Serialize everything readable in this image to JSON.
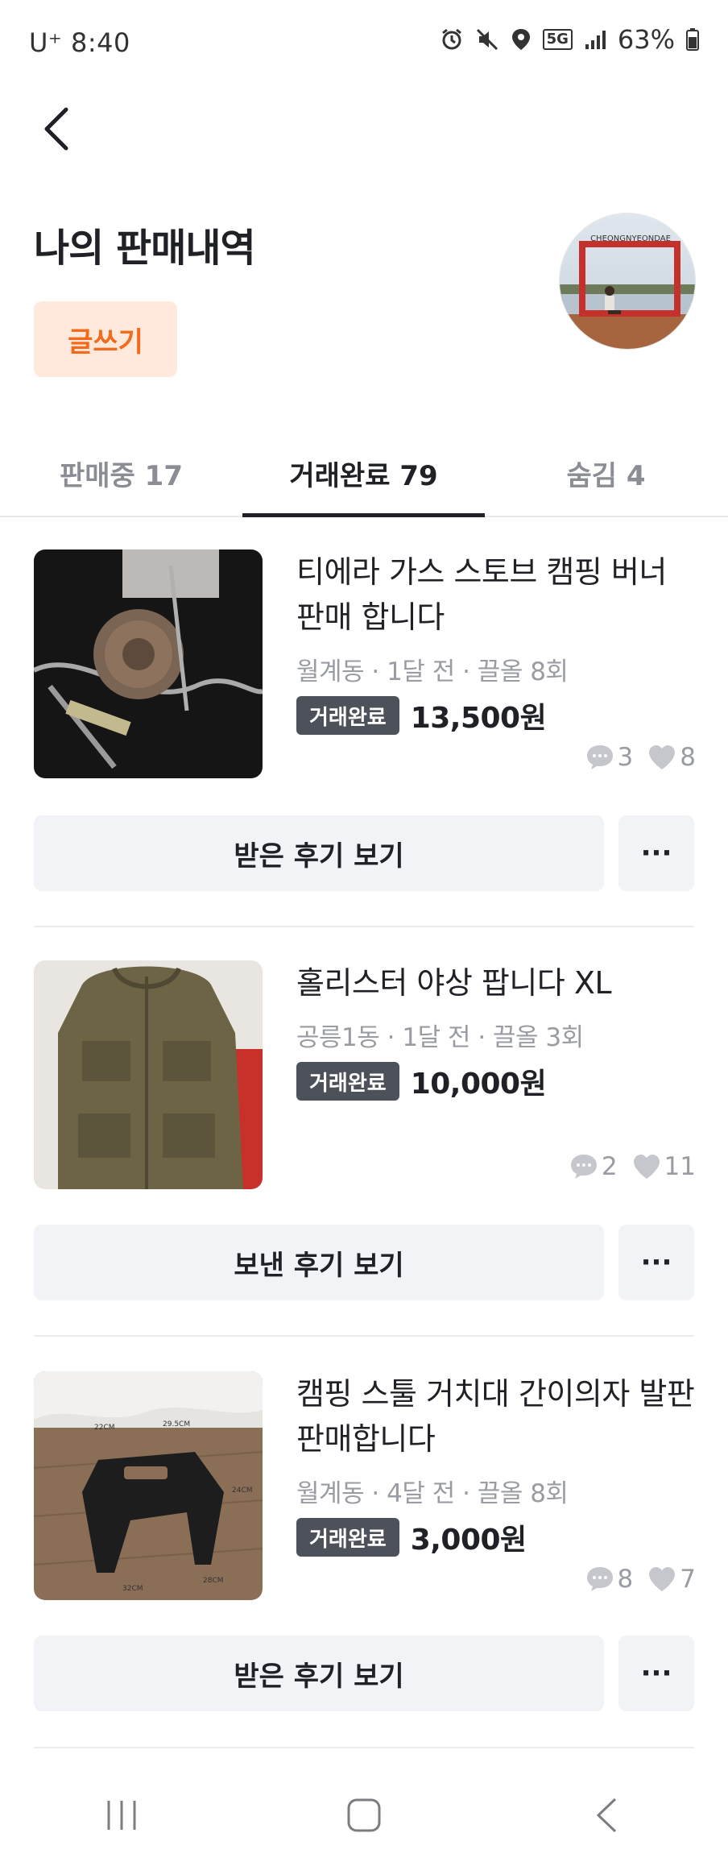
{
  "status_bar": {
    "carrier_time": "U⁺ 8:40",
    "network": "5G",
    "battery": "63%"
  },
  "header": {
    "title": "나의 판매내역",
    "write_label": "글쓰기"
  },
  "tabs": [
    {
      "label": "판매중 17",
      "active": false
    },
    {
      "label": "거래완료 79",
      "active": true
    },
    {
      "label": "숨김 4",
      "active": false
    }
  ],
  "items": [
    {
      "title_line1": "티에라 가스 스토브 캠핑 버너",
      "title_line2": "판매 합니다",
      "meta": "월계동 · 1달 전 · 끌올 8회",
      "badge": "거래완료",
      "price": "13,500원",
      "comments": "3",
      "likes": "8",
      "review_label": "받은 후기 보기",
      "more_label": "···"
    },
    {
      "title_line1": "홀리스터 야상 팝니다 XL",
      "title_line2": "",
      "meta": "공릉1동 · 1달 전 · 끌올 3회",
      "badge": "거래완료",
      "price": "10,000원",
      "comments": "2",
      "likes": "11",
      "review_label": "보낸 후기 보기",
      "more_label": "···"
    },
    {
      "title_line1": "캠핑 스툴 거치대 간이의자 발판",
      "title_line2": "판매합니다",
      "meta": "월계동 · 4달 전 · 끌올 8회",
      "badge": "거래완료",
      "price": "3,000원",
      "comments": "8",
      "likes": "7",
      "review_label": "받은 후기 보기",
      "more_label": "···"
    }
  ],
  "thumb3_dims": {
    "a": "29.5CM",
    "b": "24CM",
    "c": "32CM",
    "d": "28CM",
    "e": "22CM"
  },
  "avatar_sign": "CHEONGNYEONDAE"
}
